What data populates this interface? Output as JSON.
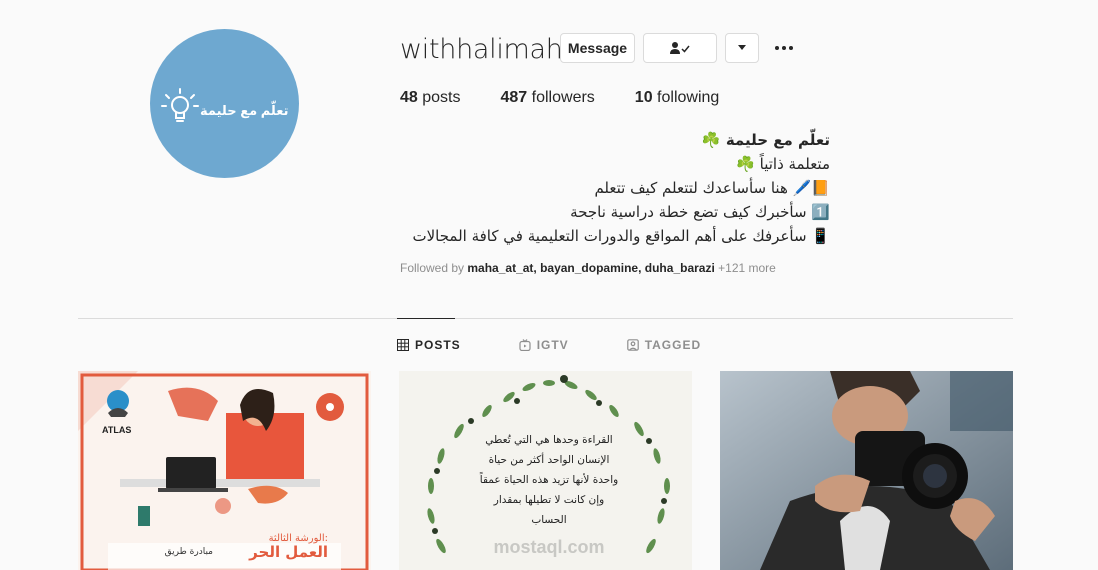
{
  "profile": {
    "username": "withhalimah",
    "avatar_text": "تعلّم مع حليمة",
    "buttons": {
      "message": "Message",
      "follow_icon": "person-check-icon",
      "dropdown_icon": "caret-down-icon",
      "more_icon": "ellipsis-icon"
    },
    "stats": {
      "posts_count": "48",
      "posts_label": "posts",
      "followers_count": "487",
      "followers_label": "followers",
      "following_count": "10",
      "following_label": "following"
    },
    "bio": {
      "name": "تعلّم مع حليمة ☘️",
      "lines": [
        "متعلمة ذاتياً ☘️",
        "📙🖊️ هنا سأساعدك لتتعلم كيف تتعلم",
        "1️⃣ سأخبرك كيف تضع خطة دراسية ناجحة",
        "📱 سأعرفك على أهم المواقع والدورات التعليمية في كافة المجالات"
      ]
    },
    "followed_by": {
      "prefix": "Followed by",
      "users": "maha_at_at, bayan_dopamine, duha_barazi",
      "more": "+121 more"
    }
  },
  "tabs": [
    {
      "label": "POSTS",
      "icon": "grid-icon",
      "active": true
    },
    {
      "label": "IGTV",
      "icon": "igtv-icon",
      "active": false
    },
    {
      "label": "TAGGED",
      "icon": "tagged-icon",
      "active": false
    }
  ],
  "posts": [
    {
      "brand": "ATLAS",
      "subtitle": "الورشة الثالثة:",
      "title": "العمل الحر",
      "tag": "مبادرة طريق"
    },
    {
      "quote": [
        "القراءة وحدها هي التي تُعطي",
        "الإنسان الواحد أكثر من حياة",
        "واحدة لأنها تزيد هذه الحياة عمقاً",
        "وإن كانت لا تطيلها بمقدار",
        "الحساب"
      ],
      "watermark": "mostaql.com"
    },
    {}
  ],
  "colors": {
    "avatar_bg": "#6ea8d0",
    "divider": "#dbdbdb",
    "text_primary": "#262626",
    "text_secondary": "#8e8e8e"
  }
}
